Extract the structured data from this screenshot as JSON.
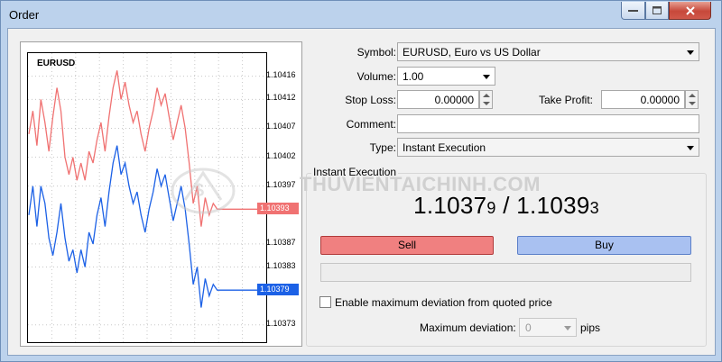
{
  "window": {
    "title": "Order",
    "minimize_icon": "minimize-icon",
    "maximize_icon": "maximize-icon",
    "close_icon": "close-icon",
    "close_color": "#c7483a"
  },
  "chart": {
    "symbol": "EURUSD",
    "price_ticks": [
      "1.10416",
      "1.10412",
      "1.10407",
      "1.10402",
      "1.10397",
      "1.10387",
      "1.10383",
      "1.10373"
    ],
    "ask_tag": "1.10393",
    "bid_tag": "1.10379",
    "ask_color": "#f07272",
    "bid_color": "#1c61e6"
  },
  "chart_data": {
    "type": "line",
    "title": "EURUSD",
    "xlabel": "",
    "ylabel": "",
    "ylim": [
      1.1037,
      1.1042
    ],
    "grid": true,
    "series": [
      {
        "color": "#f07272",
        "values": [
          1.10406,
          1.1041,
          1.10404,
          1.10412,
          1.10408,
          1.10403,
          1.10409,
          1.10414,
          1.1041,
          1.10402,
          1.10399,
          1.10402,
          1.10398,
          1.10401,
          1.10398,
          1.10403,
          1.10401,
          1.10405,
          1.10408,
          1.10403,
          1.10409,
          1.10414,
          1.10417,
          1.10412,
          1.10415,
          1.10411,
          1.10408,
          1.1041,
          1.10406,
          1.10403,
          1.10407,
          1.1041,
          1.10414,
          1.10411,
          1.10413,
          1.10409,
          1.10405,
          1.10408,
          1.10411,
          1.10407,
          1.10401,
          1.10394,
          1.10397,
          1.1039,
          1.10395,
          1.10392,
          1.10394,
          1.10393,
          1.10393,
          1.10393,
          1.10393,
          1.10393,
          1.10393,
          1.10393,
          1.10393,
          1.10393,
          1.10393,
          1.10393,
          1.10393,
          1.10393
        ]
      },
      {
        "color": "#1c61e6",
        "values": [
          1.10392,
          1.10397,
          1.1039,
          1.10397,
          1.10394,
          1.10388,
          1.10385,
          1.10389,
          1.10394,
          1.10388,
          1.10384,
          1.10386,
          1.10382,
          1.10386,
          1.10383,
          1.10389,
          1.10387,
          1.10392,
          1.10395,
          1.1039,
          1.10396,
          1.10401,
          1.10404,
          1.10399,
          1.10401,
          1.10397,
          1.10394,
          1.10396,
          1.10392,
          1.10389,
          1.10393,
          1.10396,
          1.104,
          1.10397,
          1.10399,
          1.10395,
          1.10391,
          1.10394,
          1.10397,
          1.10393,
          1.10387,
          1.1038,
          1.10383,
          1.10376,
          1.10381,
          1.10378,
          1.1038,
          1.10379,
          1.10379,
          1.10379,
          1.10379,
          1.10379,
          1.10379,
          1.10379,
          1.10379,
          1.10379,
          1.10379,
          1.10379,
          1.10379,
          1.10379
        ]
      }
    ]
  },
  "form": {
    "symbol_label": "Symbol:",
    "symbol_value": "EURUSD, Euro vs US Dollar",
    "volume_label": "Volume:",
    "volume_value": "1.00",
    "stoploss_label": "Stop Loss:",
    "stoploss_value": "0.00000",
    "takeprofit_label": "Take Profit:",
    "takeprofit_value": "0.00000",
    "comment_label": "Comment:",
    "comment_value": "",
    "type_label": "Type:",
    "type_value": "Instant Execution"
  },
  "execution": {
    "group_title": "Instant Execution",
    "bid_main": "1.1037",
    "bid_last": "9",
    "separator": "/",
    "ask_main": "1.1039",
    "ask_last": "3",
    "sell_label": "Sell",
    "buy_label": "Buy",
    "sell_color": "#f08080",
    "buy_color": "#a9c1f1",
    "deviation_checkbox_label": "Enable maximum deviation from quoted price",
    "deviation_checked": false,
    "max_deviation_label": "Maximum deviation:",
    "max_deviation_value": "0",
    "pips_label": "pips"
  },
  "watermark": {
    "text": "THUVIENTAICHINH.COM"
  }
}
